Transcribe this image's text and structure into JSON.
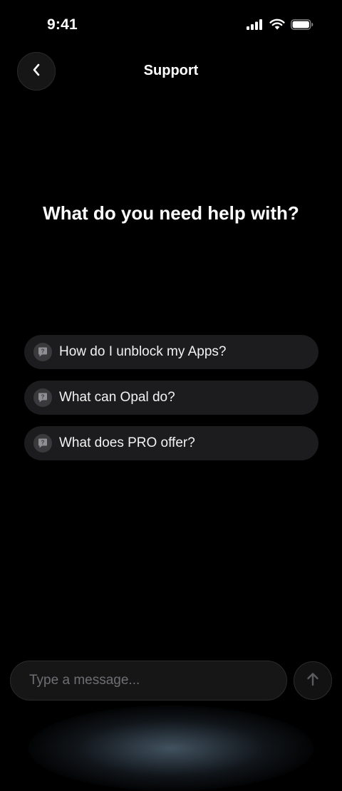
{
  "status_bar": {
    "time": "9:41",
    "icons": [
      "cellular-signal-icon",
      "wifi-icon",
      "battery-icon"
    ]
  },
  "nav": {
    "back_icon": "chevron-left-icon",
    "title": "Support"
  },
  "headline": "What do you need help with?",
  "suggestions": [
    {
      "icon": "question-bubble-icon",
      "label": "How do I unblock my Apps?"
    },
    {
      "icon": "question-bubble-icon",
      "label": "What can Opal do?"
    },
    {
      "icon": "question-bubble-icon",
      "label": "What does PRO offer?"
    }
  ],
  "composer": {
    "placeholder": "Type a message...",
    "value": "",
    "send_icon": "arrow-up-icon"
  },
  "colors": {
    "background": "#000000",
    "chip": "#1c1c1e",
    "placeholder": "#6e6e73",
    "glow": "#7896af"
  }
}
